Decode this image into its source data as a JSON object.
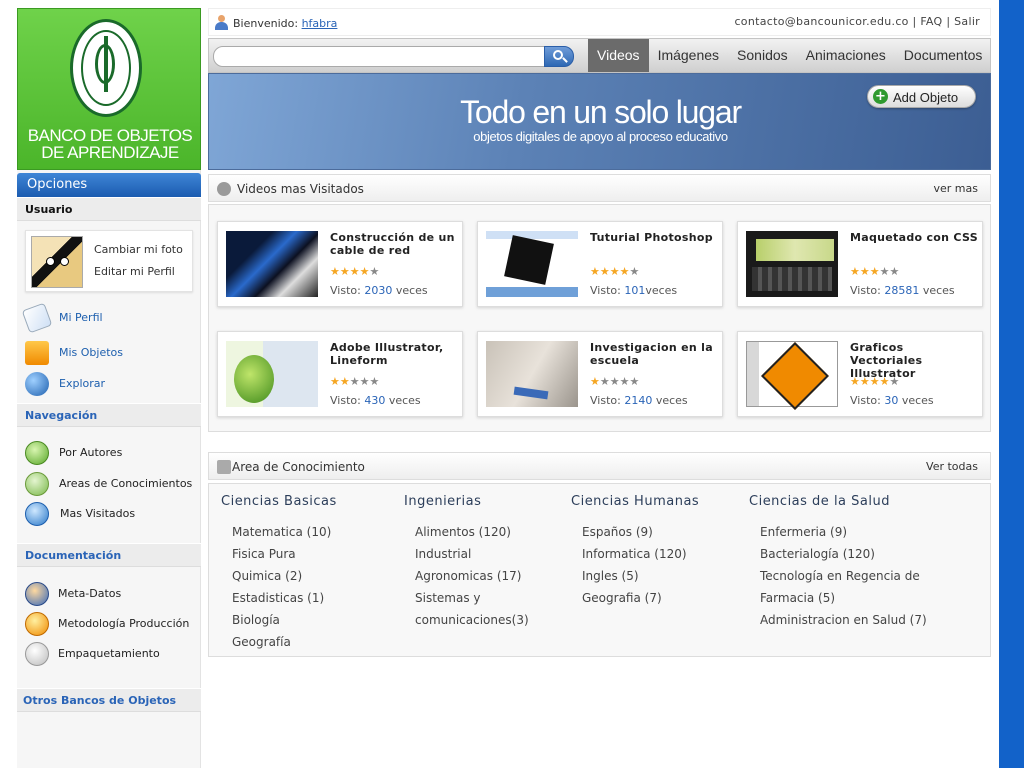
{
  "sidebar": {
    "logo_text_line1": "BANCO DE OBJETOS",
    "logo_text_line2": "DE APRENDIZAJE",
    "opciones": "Opciones",
    "usuario_head": "Usuario",
    "user_links": [
      "Cambiar mi foto",
      "Editar mi Perfil"
    ],
    "user_nav": [
      {
        "label": "Mi Perfil",
        "icon": "profile-card-icon"
      },
      {
        "label": "Mis Objetos",
        "icon": "box-icon"
      },
      {
        "label": "Explorar",
        "icon": "globe-icon"
      }
    ],
    "navegacion_head": "Navegación",
    "navegacion": [
      {
        "label": "Por Autores",
        "icon": "user-icon"
      },
      {
        "label": "Areas de Conocimientos",
        "icon": "puzzle-icon"
      },
      {
        "label": "Mas Visitados",
        "icon": "document-icon"
      }
    ],
    "documentacion_head": "Documentación",
    "documentacion": [
      {
        "label": "Meta-Datos",
        "icon": "metadata-icon"
      },
      {
        "label": "Metodología Producción",
        "icon": "methodology-icon"
      },
      {
        "label": "Empaquetamiento",
        "icon": "package-icon"
      }
    ],
    "otros_head": "Otros Bancos de Objetos"
  },
  "topbar": {
    "welcome": "Bienvenido:",
    "username": "hfabra",
    "contact": "contacto@bancounicor.edu.co",
    "faq": "FAQ",
    "logout": "Salir"
  },
  "menu": {
    "search_placeholder": "",
    "tabs": [
      "Videos",
      "Imágenes",
      "Sonidos",
      "Animaciones",
      "Documentos"
    ],
    "active_tab": "Videos"
  },
  "banner": {
    "title": "Todo en un solo lugar",
    "subtitle": "objetos digitales de apoyo al proceso educativo",
    "add_button": "Add Objeto"
  },
  "videos": {
    "title": "Videos mas Visitados",
    "more": "ver mas",
    "views_prefix": "Visto:",
    "items": [
      {
        "title": "Construcción de un cable de red",
        "rating": 4,
        "views": "2030",
        "suffix": " veces"
      },
      {
        "title": "Tuturial Photoshop",
        "rating": 4,
        "views": "101",
        "suffix": "veces"
      },
      {
        "title": "Maquetado con CSS",
        "rating": 3,
        "views": "28581",
        "suffix": " veces"
      },
      {
        "title": "Adobe Illustrator, Lineform",
        "rating": 2,
        "views": "430",
        "suffix": " veces"
      },
      {
        "title": "Investigacion en la escuela",
        "rating": 1,
        "views": "2140",
        "suffix": " veces"
      },
      {
        "title": "Graficos Vectoriales Illustrator",
        "rating": 4,
        "views": "30",
        "suffix": " veces"
      }
    ]
  },
  "areas": {
    "title": "Area de Conocimiento",
    "more": "Ver todas",
    "columns": [
      {
        "head": "Ciencias Basicas",
        "items": [
          "Matematica (10)",
          "Fisica Pura",
          "Quimica (2)",
          "Estadisticas (1)",
          "Biología",
          "Geografía"
        ]
      },
      {
        "head": "Ingenierias",
        "items": [
          "Alimentos (120)",
          "Industrial",
          "Agronomicas (17)",
          "Sistemas y",
          "comunicaciones(3)"
        ]
      },
      {
        "head": "Ciencias Humanas",
        "items": [
          "Españos (9)",
          "Informatica (120)",
          "Ingles (5)",
          "Geografia (7)"
        ]
      },
      {
        "head": "Ciencias de la Salud",
        "items": [
          "Enfermeria (9)",
          "Bacterialogía (120)",
          "Tecnología en Regencia de",
          "Farmacia (5)",
          "Administracion en Salud (7)"
        ]
      }
    ]
  },
  "colors": {
    "accent_blue": "#1d5fae",
    "brand_green": "#4bb52a",
    "frame_blue": "#1262c9",
    "star": "#f5a623"
  }
}
